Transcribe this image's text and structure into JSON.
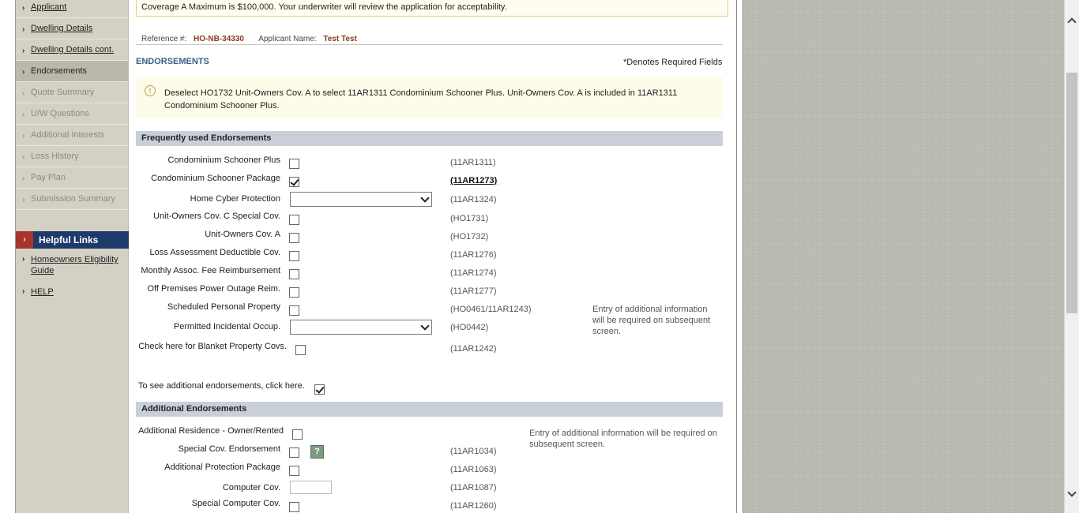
{
  "sidebar": {
    "items": [
      {
        "label": "Applicant",
        "state": "link"
      },
      {
        "label": "Dwelling Details",
        "state": "link"
      },
      {
        "label": "Dwelling Details cont.",
        "state": "link"
      },
      {
        "label": "Endorsements",
        "state": "current"
      },
      {
        "label": "Quote Summary",
        "state": "disabled"
      },
      {
        "label": "U/W Questions",
        "state": "disabled"
      },
      {
        "label": "Additional Interests",
        "state": "disabled"
      },
      {
        "label": "Loss History",
        "state": "disabled"
      },
      {
        "label": "Pay Plan",
        "state": "disabled"
      },
      {
        "label": "Submission Summary",
        "state": "disabled"
      }
    ],
    "helpful_links_title": "Helpful Links",
    "helpful_links": [
      {
        "label": "Homeowners Eligibility Guide"
      },
      {
        "label": "HELP"
      }
    ]
  },
  "notice": "Coverage A Maximum is $100,000. Your underwriter will review the application for acceptability.",
  "reference": {
    "ref_label": "Reference #:",
    "ref_value": "HO-NB-34330",
    "applicant_label": "Applicant Name:",
    "applicant_value": "Test Test"
  },
  "section_title": "ENDORSEMENTS",
  "required_note": "*Denotes Required Fields",
  "info_message": "Deselect HO1732 Unit-Owners Cov. A to select 11AR1311 Condominium Schooner Plus. Unit-Owners Cov. A is included in 11AR1311 Condominium Schooner Plus.",
  "frequent": {
    "title": "Frequently used Endorsements",
    "rows": [
      {
        "label": "Condominium Schooner Plus",
        "control": "checkbox",
        "checked": false,
        "code": "(11AR1311)"
      },
      {
        "label": "Condominium Schooner Package",
        "control": "checkbox",
        "checked": true,
        "code": "(11AR1273)"
      },
      {
        "label": "Home Cyber Protection",
        "control": "select",
        "value": "",
        "code": "(11AR1324)"
      },
      {
        "label": "Unit-Owners Cov. C Special Cov.",
        "control": "checkbox",
        "checked": false,
        "code": "(HO1731)"
      },
      {
        "label": "Unit-Owners Cov. A",
        "control": "checkbox",
        "checked": false,
        "code": "(HO1732)"
      },
      {
        "label": "Loss Assessment Deductible Cov.",
        "control": "checkbox",
        "checked": false,
        "code": "(11AR1276)"
      },
      {
        "label": "Monthly Assoc. Fee Reimbursement",
        "control": "checkbox",
        "checked": false,
        "code": "(11AR1274)"
      },
      {
        "label": "Off Premises Power Outage Reim.",
        "control": "checkbox",
        "checked": false,
        "code": "(11AR1277)"
      },
      {
        "label": "Scheduled Personal Property",
        "control": "checkbox",
        "checked": false,
        "code": "(HO0461/11AR1243)"
      },
      {
        "label": "Permitted Incidental Occup.",
        "control": "select",
        "value": "",
        "code": "(HO0442)"
      },
      {
        "label": "Check here for Blanket Property Covs.",
        "control": "checkbox",
        "checked": false,
        "code": "(11AR1242)"
      }
    ],
    "side_note": "Entry of additional information will be required on subsequent screen."
  },
  "additional_toggle": {
    "label": "To see additional endorsements, click here.",
    "checked": true
  },
  "additional": {
    "title": "Additional Endorsements",
    "rows": [
      {
        "label": "Additional Residence - Owner/Rented",
        "control": "checkbox",
        "checked": false,
        "code": ""
      },
      {
        "label": "Special Cov. Endorsement",
        "control": "checkbox",
        "checked": false,
        "code": "(11AR1034)",
        "help_icon": "?"
      },
      {
        "label": "Additional Protection Package",
        "control": "checkbox",
        "checked": false,
        "code": "(11AR1063)"
      },
      {
        "label": "Computer Cov.",
        "control": "text",
        "value": "",
        "code": "(11AR1087)"
      },
      {
        "label": "Special Computer Cov.",
        "control": "checkbox",
        "checked": false,
        "code": "(11AR1260)"
      }
    ],
    "side_note": "Entry of additional information will be required on subsequent screen."
  },
  "icons": {
    "nav_arrow": "chevron-right-icon",
    "info": "lightbulb-icon",
    "help": "question-icon"
  }
}
